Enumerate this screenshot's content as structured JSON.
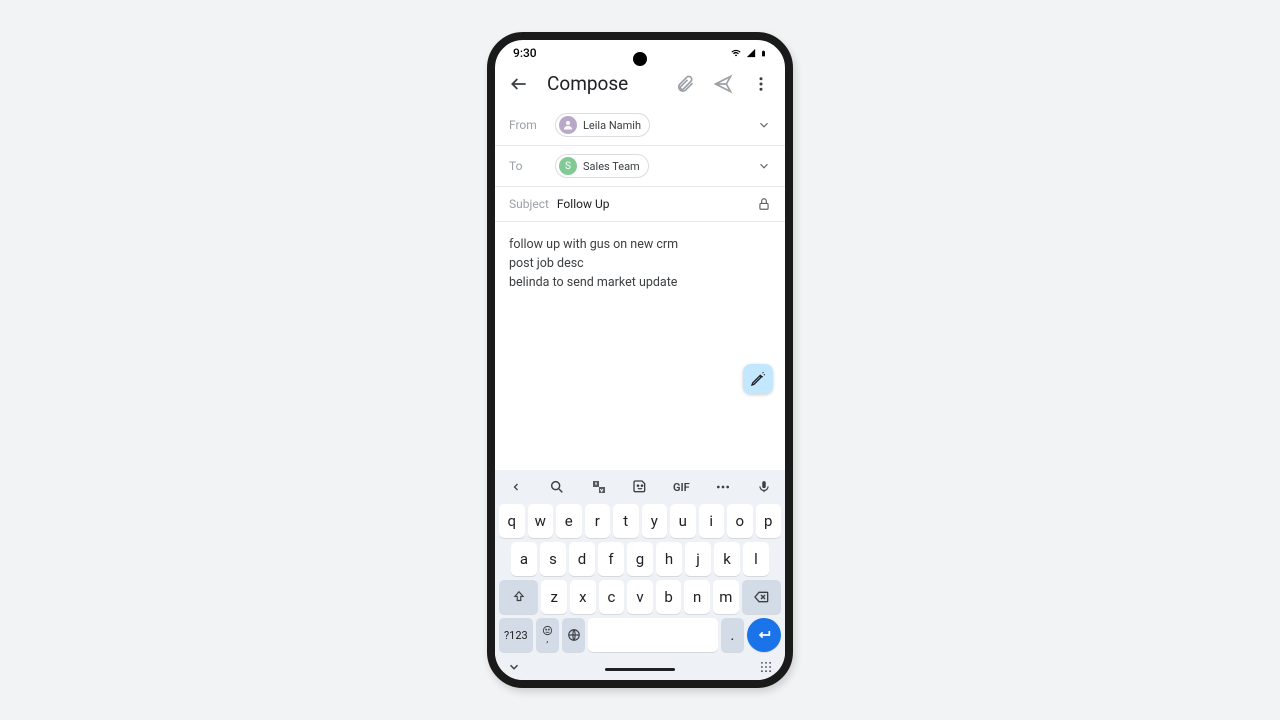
{
  "status": {
    "time": "9:30"
  },
  "appbar": {
    "title": "Compose"
  },
  "from": {
    "label": "From",
    "chip_name": "Leila Namih"
  },
  "to": {
    "label": "To",
    "chip_name": "Sales Team",
    "chip_initial": "S"
  },
  "subject": {
    "label": "Subject",
    "value": "Follow Up"
  },
  "body": {
    "text": "follow up with gus on new crm\npost job desc\nbelinda to send market update"
  },
  "keyboard": {
    "gif_label": "GIF",
    "row1": [
      "q",
      "w",
      "e",
      "r",
      "t",
      "y",
      "u",
      "i",
      "o",
      "p"
    ],
    "row2": [
      "a",
      "s",
      "d",
      "f",
      "g",
      "h",
      "j",
      "k",
      "l"
    ],
    "row3": [
      "z",
      "x",
      "c",
      "v",
      "b",
      "n",
      "m"
    ],
    "sym_label": "?123",
    "comma": ",",
    "period": "."
  }
}
